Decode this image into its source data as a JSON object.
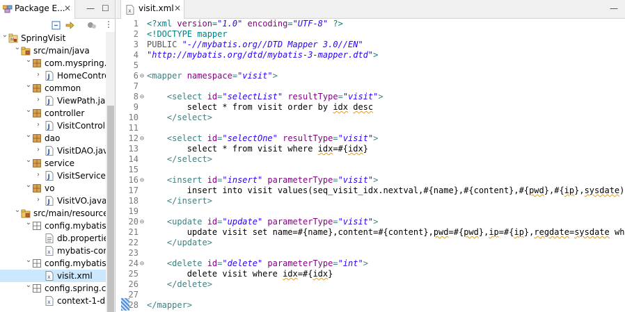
{
  "explorer": {
    "tab_label": "Package E...",
    "close_glyph": "✕",
    "tree": [
      {
        "label": "SpringVisit",
        "depth": 0,
        "state": "open",
        "icon": "project-icon"
      },
      {
        "label": "src/main/java",
        "depth": 1,
        "state": "open",
        "icon": "source-folder-icon"
      },
      {
        "label": "com.myspring.v",
        "depth": 2,
        "state": "open",
        "icon": "package-icon"
      },
      {
        "label": "HomeContro",
        "depth": 3,
        "state": "closed",
        "icon": "java-file-icon"
      },
      {
        "label": "common",
        "depth": 2,
        "state": "open",
        "icon": "package-icon"
      },
      {
        "label": "ViewPath.java",
        "depth": 3,
        "state": "closed",
        "icon": "java-file-icon"
      },
      {
        "label": "controller",
        "depth": 2,
        "state": "open",
        "icon": "package-icon"
      },
      {
        "label": "VisitControll",
        "depth": 3,
        "state": "closed",
        "icon": "java-file-icon"
      },
      {
        "label": "dao",
        "depth": 2,
        "state": "open",
        "icon": "package-icon"
      },
      {
        "label": "VisitDAO.java",
        "depth": 3,
        "state": "closed",
        "icon": "java-file-icon"
      },
      {
        "label": "service",
        "depth": 2,
        "state": "open",
        "icon": "package-icon"
      },
      {
        "label": "VisitService.j",
        "depth": 3,
        "state": "closed",
        "icon": "java-file-icon"
      },
      {
        "label": "vo",
        "depth": 2,
        "state": "open",
        "icon": "package-icon"
      },
      {
        "label": "VisitVO.java",
        "depth": 3,
        "state": "closed",
        "icon": "java-file-icon"
      },
      {
        "label": "src/main/resource",
        "depth": 1,
        "state": "open",
        "icon": "resource-folder-icon"
      },
      {
        "label": "config.mybatis",
        "depth": 2,
        "state": "open",
        "icon": "package-folder-icon"
      },
      {
        "label": "db.properties",
        "depth": 3,
        "state": "none",
        "icon": "properties-file-icon"
      },
      {
        "label": "mybatis-con",
        "depth": 3,
        "state": "none",
        "icon": "xml-file-icon"
      },
      {
        "label": "config.mybatis.",
        "depth": 2,
        "state": "open",
        "icon": "package-folder-icon"
      },
      {
        "label": "visit.xml",
        "depth": 3,
        "state": "none",
        "icon": "xml-file-icon",
        "selected": true
      },
      {
        "label": "config.spring.co",
        "depth": 2,
        "state": "open",
        "icon": "package-folder-icon"
      },
      {
        "label": "context-1-da",
        "depth": 3,
        "state": "none",
        "icon": "xml-file-icon"
      }
    ]
  },
  "editor": {
    "tab_label": "visit.xml",
    "close_glyph": "✕",
    "lines": [
      {
        "n": "1",
        "fold": "",
        "segs": [
          [
            "pi",
            "<?xml "
          ],
          [
            "attr",
            "version"
          ],
          [
            "pi",
            "="
          ],
          [
            "str",
            "\"1.0\""
          ],
          [
            "pi",
            " "
          ],
          [
            "attr",
            "encoding"
          ],
          [
            "pi",
            "="
          ],
          [
            "str",
            "\"UTF-8\""
          ],
          [
            "pi",
            " ?>"
          ]
        ]
      },
      {
        "n": "2",
        "fold": "",
        "segs": [
          [
            "doc",
            "<!DOCTYPE mapper"
          ]
        ]
      },
      {
        "n": "3",
        "fold": "",
        "segs": [
          [
            "gray",
            "PUBLIC "
          ],
          [
            "str",
            "\"-//mybatis.org//DTD Mapper 3.0//EN\""
          ]
        ]
      },
      {
        "n": "4",
        "fold": "",
        "segs": [
          [
            "str",
            "\"http://mybatis.org/dtd/mybatis-3-mapper.dtd\""
          ],
          [
            "doc",
            ">"
          ]
        ]
      },
      {
        "n": "5",
        "fold": "",
        "segs": []
      },
      {
        "n": "6",
        "fold": "⊖",
        "segs": [
          [
            "tag",
            "<mapper "
          ],
          [
            "attr",
            "namespace"
          ],
          [
            "tag",
            "="
          ],
          [
            "str",
            "\"visit\""
          ],
          [
            "tag",
            ">"
          ]
        ]
      },
      {
        "n": "7",
        "fold": "",
        "segs": []
      },
      {
        "n": "8",
        "fold": "⊖",
        "segs": [
          [
            "text",
            "    "
          ],
          [
            "tag",
            "<select "
          ],
          [
            "attr",
            "id"
          ],
          [
            "tag",
            "="
          ],
          [
            "str",
            "\"selectList\""
          ],
          [
            "tag",
            " "
          ],
          [
            "attr",
            "resultType"
          ],
          [
            "tag",
            "="
          ],
          [
            "str",
            "\"visit\""
          ],
          [
            "tag",
            ">"
          ]
        ]
      },
      {
        "n": "9",
        "fold": "",
        "segs": [
          [
            "text",
            "        select * from visit order by "
          ],
          [
            "sq",
            "idx"
          ],
          [
            "text",
            " "
          ],
          [
            "sq",
            "desc"
          ]
        ]
      },
      {
        "n": "10",
        "fold": "",
        "segs": [
          [
            "text",
            "    "
          ],
          [
            "tag",
            "</select>"
          ]
        ]
      },
      {
        "n": "11",
        "fold": "",
        "segs": []
      },
      {
        "n": "12",
        "fold": "⊖",
        "segs": [
          [
            "text",
            "    "
          ],
          [
            "tag",
            "<select "
          ],
          [
            "attr",
            "id"
          ],
          [
            "tag",
            "="
          ],
          [
            "str",
            "\"selectOne\""
          ],
          [
            "tag",
            " "
          ],
          [
            "attr",
            "resultType"
          ],
          [
            "tag",
            "="
          ],
          [
            "str",
            "\"visit\""
          ],
          [
            "tag",
            ">"
          ]
        ]
      },
      {
        "n": "13",
        "fold": "",
        "segs": [
          [
            "text",
            "        select * from visit where "
          ],
          [
            "sq",
            "idx"
          ],
          [
            "text",
            "=#{"
          ],
          [
            "sq",
            "idx"
          ],
          [
            "text",
            "}"
          ]
        ]
      },
      {
        "n": "14",
        "fold": "",
        "segs": [
          [
            "text",
            "    "
          ],
          [
            "tag",
            "</select>"
          ]
        ]
      },
      {
        "n": "15",
        "fold": "",
        "segs": []
      },
      {
        "n": "16",
        "fold": "⊖",
        "segs": [
          [
            "text",
            "    "
          ],
          [
            "tag",
            "<insert "
          ],
          [
            "attr",
            "id"
          ],
          [
            "tag",
            "="
          ],
          [
            "str",
            "\"insert\""
          ],
          [
            "tag",
            " "
          ],
          [
            "attr",
            "parameterType"
          ],
          [
            "tag",
            "="
          ],
          [
            "str",
            "\"visit\""
          ],
          [
            "tag",
            ">"
          ]
        ]
      },
      {
        "n": "17",
        "fold": "",
        "segs": [
          [
            "text",
            "        insert into visit values(seq_visit_idx.nextval,#{name},#{content},#{"
          ],
          [
            "sq",
            "pwd"
          ],
          [
            "text",
            "},#{"
          ],
          [
            "sq",
            "ip"
          ],
          [
            "text",
            "},"
          ],
          [
            "sq",
            "sysdate"
          ],
          [
            "text",
            ")"
          ]
        ]
      },
      {
        "n": "18",
        "fold": "",
        "segs": [
          [
            "text",
            "    "
          ],
          [
            "tag",
            "</insert>"
          ]
        ]
      },
      {
        "n": "19",
        "fold": "",
        "segs": []
      },
      {
        "n": "20",
        "fold": "⊖",
        "segs": [
          [
            "text",
            "    "
          ],
          [
            "tag",
            "<update "
          ],
          [
            "attr",
            "id"
          ],
          [
            "tag",
            "="
          ],
          [
            "str",
            "\"update\""
          ],
          [
            "tag",
            " "
          ],
          [
            "attr",
            "parameterType"
          ],
          [
            "tag",
            "="
          ],
          [
            "str",
            "\"visit\""
          ],
          [
            "tag",
            ">"
          ]
        ]
      },
      {
        "n": "21",
        "fold": "",
        "segs": [
          [
            "text",
            "        update visit set name=#{name},content=#{content},"
          ],
          [
            "sq",
            "pwd"
          ],
          [
            "text",
            "=#{"
          ],
          [
            "sq",
            "pwd"
          ],
          [
            "text",
            "},"
          ],
          [
            "sq",
            "ip"
          ],
          [
            "text",
            "=#{"
          ],
          [
            "sq",
            "ip"
          ],
          [
            "text",
            "},"
          ],
          [
            "sq",
            "regdate"
          ],
          [
            "text",
            "="
          ],
          [
            "sq",
            "sysdate"
          ],
          [
            "text",
            " where"
          ]
        ]
      },
      {
        "n": "22",
        "fold": "",
        "segs": [
          [
            "text",
            "    "
          ],
          [
            "tag",
            "</update>"
          ]
        ]
      },
      {
        "n": "23",
        "fold": "",
        "segs": []
      },
      {
        "n": "24",
        "fold": "⊖",
        "segs": [
          [
            "text",
            "    "
          ],
          [
            "tag",
            "<delete "
          ],
          [
            "attr",
            "id"
          ],
          [
            "tag",
            "="
          ],
          [
            "str",
            "\"delete\""
          ],
          [
            "tag",
            " "
          ],
          [
            "attr",
            "parameterType"
          ],
          [
            "tag",
            "="
          ],
          [
            "str",
            "\"int\""
          ],
          [
            "tag",
            ">"
          ]
        ]
      },
      {
        "n": "25",
        "fold": "",
        "segs": [
          [
            "text",
            "        delete visit where "
          ],
          [
            "sq",
            "idx"
          ],
          [
            "text",
            "=#{"
          ],
          [
            "sq",
            "idx"
          ],
          [
            "text",
            "}"
          ]
        ]
      },
      {
        "n": "26",
        "fold": "",
        "segs": [
          [
            "text",
            "    "
          ],
          [
            "tag",
            "</delete>"
          ]
        ]
      },
      {
        "n": "27",
        "fold": "",
        "segs": []
      },
      {
        "n": "28",
        "fold": "",
        "segs": [
          [
            "tag",
            "</mapper>"
          ]
        ]
      }
    ]
  },
  "colors": {
    "selection": "#cce8ff",
    "tag": "#3f7f7f",
    "attr": "#7f007f",
    "string": "#2a00ff"
  }
}
